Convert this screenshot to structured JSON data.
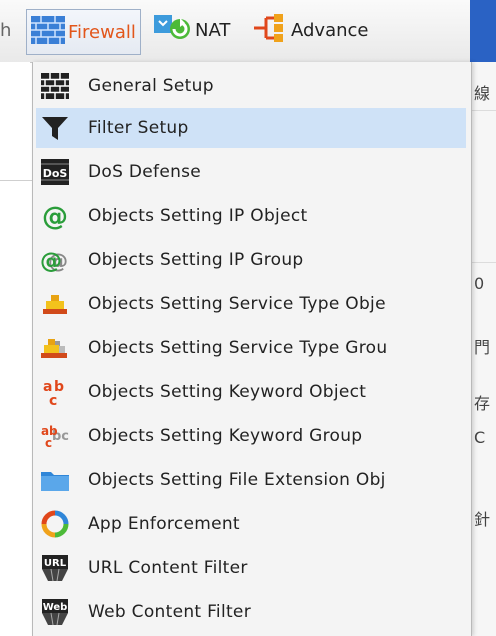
{
  "toolbar": {
    "cut_label": "h",
    "firewall_label": "Firewall",
    "nat_label": "NAT",
    "advance_label": "Advance"
  },
  "menu": {
    "items": [
      {
        "label": "General Setup",
        "icon": "brick-wall-icon"
      },
      {
        "label": "Filter Setup",
        "icon": "funnel-icon",
        "selected": true
      },
      {
        "label": "DoS Defense",
        "icon": "dos-icon"
      },
      {
        "label": "Objects Setting IP Object",
        "icon": "at-icon"
      },
      {
        "label": "Objects Setting IP Group",
        "icon": "at-group-icon"
      },
      {
        "label": "Objects Setting Service Type Obje",
        "icon": "service-type-icon"
      },
      {
        "label": "Objects Setting Service Type Grou",
        "icon": "service-type-group-icon"
      },
      {
        "label": "Objects Setting Keyword Object",
        "icon": "keyword-icon"
      },
      {
        "label": "Objects Setting Keyword Group",
        "icon": "keyword-group-icon"
      },
      {
        "label": "Objects Setting File Extension Obj",
        "icon": "folder-icon"
      },
      {
        "label": "App Enforcement",
        "icon": "app-ring-icon"
      },
      {
        "label": "URL Content Filter",
        "icon": "url-icon"
      },
      {
        "label": "Web Content Filter",
        "icon": "web-icon"
      }
    ]
  },
  "background": {
    "right_glyphs": [
      "線",
      "0",
      "門",
      "存",
      "C",
      "針"
    ]
  },
  "colors": {
    "firewall_text": "#e2561b",
    "selected_row": "#cfe2f7",
    "side_blue": "#2a62c4"
  }
}
